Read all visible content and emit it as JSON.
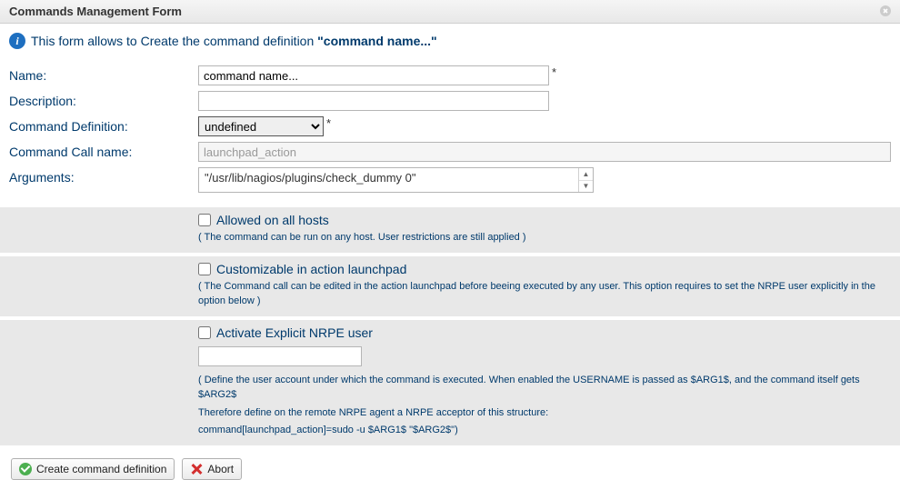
{
  "window": {
    "title": "Commands Management Form"
  },
  "intro": {
    "prefix": "This form allows to Create the command definition ",
    "bold": "\"command name...\""
  },
  "fields": {
    "name": {
      "label": "Name:",
      "value": "command name..."
    },
    "description": {
      "label": "Description:",
      "value": ""
    },
    "definition": {
      "label": "Command Definition:",
      "selected": "undefined"
    },
    "callname": {
      "label": "Command Call name:",
      "value": "launchpad_action"
    },
    "arguments": {
      "label": "Arguments:",
      "value": "\"/usr/lib/nagios/plugins/check_dummy 0\""
    }
  },
  "options": {
    "allowed": {
      "label": "Allowed on all hosts",
      "desc": "( The command can be run on any host. User restrictions are still applied )"
    },
    "customizable": {
      "label": "Customizable in action launchpad",
      "desc": "( The Command call can be edited in the action launchpad before beeing executed by any user. This option requires to set the NRPE user explicitly in the option below )"
    },
    "nrpe": {
      "label": "Activate Explicit NRPE user",
      "input": "",
      "desc1": "( Define the user account under which the command is executed. When enabled the USERNAME is passed as $ARG1$, and the command itself gets $ARG2$",
      "desc2": "Therefore define on the remote NRPE agent a NRPE acceptor of this structure:",
      "desc3": "command[launchpad_action]=sudo -u $ARG1$ \"$ARG2$\")"
    }
  },
  "buttons": {
    "create": "Create command definition",
    "abort": "Abort"
  }
}
